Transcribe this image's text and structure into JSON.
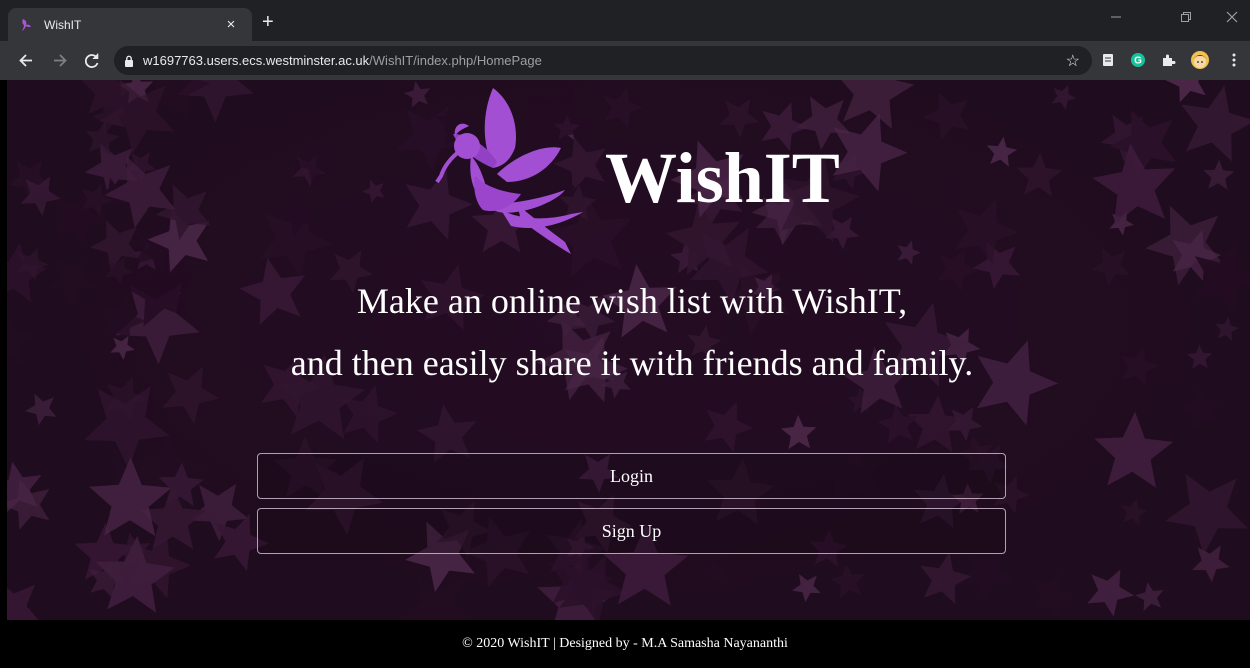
{
  "browser": {
    "tab_title": "WishIT",
    "tab_close": "×",
    "new_tab": "+",
    "url_host": "w1697763.users.ecs.westminster.ac.uk",
    "url_path": "/WishIT/index.php/HomePage",
    "icons": [
      "back-icon",
      "forward-icon",
      "reload-icon",
      "lock-icon",
      "star-icon",
      "reader-icon",
      "grammarly-icon",
      "extensions-icon",
      "avatar",
      "menu-icon",
      "minimize-icon",
      "restore-icon",
      "close-window-icon"
    ]
  },
  "hero": {
    "brand": "WishIT",
    "tagline_line1": "Make an online wish list with WishIT,",
    "tagline_line2": "and then easily share it with friends and family.",
    "login_label": "Login",
    "signup_label": "Sign Up"
  },
  "footer": {
    "text": "© 2020 WishIT | Designed by - M.A Samasha Nayananthi"
  },
  "colors": {
    "accent": "#9b3fc8",
    "background": "#2a1228",
    "footer_bg": "#000000"
  }
}
